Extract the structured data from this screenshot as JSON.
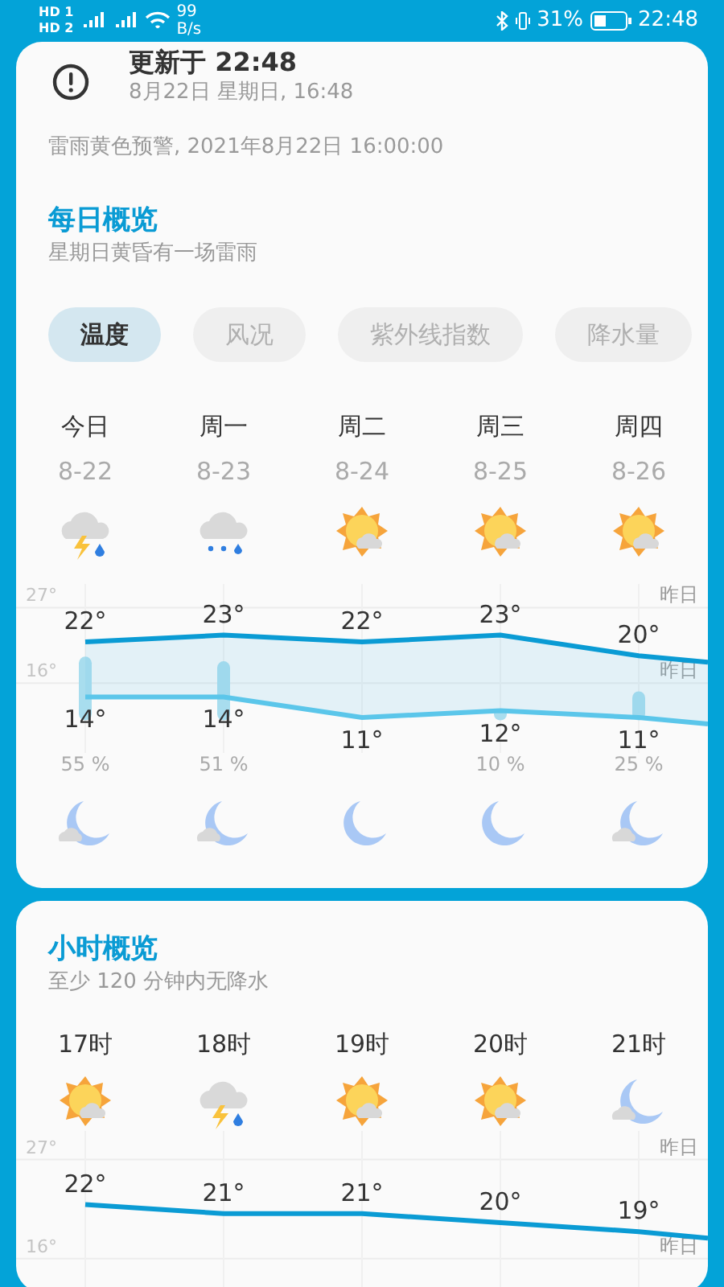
{
  "status_bar": {
    "sim_1": "HD 1",
    "sim_2": "HD 2",
    "net_speed": "99",
    "net_unit": "B/s",
    "battery": "31%",
    "time": "22:48"
  },
  "update": {
    "title": "更新于 22:48",
    "subtitle": "8月22日 星期日, 16:48"
  },
  "alert": "雷雨黄色预警, 2021年8月22日 16:00:00",
  "daily": {
    "title": "每日概览",
    "subtitle": "星期日黄昏有一场雷雨",
    "tabs": [
      {
        "label": "温度",
        "selected": true
      },
      {
        "label": "风况",
        "selected": false
      },
      {
        "label": "紫外线指数",
        "selected": false
      },
      {
        "label": "降水量",
        "selected": false
      }
    ],
    "ticks": [
      {
        "label": "27°",
        "ref": "昨日"
      },
      {
        "label": "16°",
        "ref": "昨日"
      }
    ],
    "days": [
      {
        "name": "今日",
        "date": "8-22",
        "day_icon": {
          "kind": "thunderstorm"
        },
        "high": "22°",
        "low": "14°",
        "rain": "55 %",
        "night_icon": {
          "kind": "cloudynight"
        }
      },
      {
        "name": "周一",
        "date": "8-23",
        "day_icon": {
          "kind": "rain"
        },
        "high": "23°",
        "low": "14°",
        "rain": "51 %",
        "night_icon": {
          "kind": "cloudynight"
        }
      },
      {
        "name": "周二",
        "date": "8-24",
        "day_icon": {
          "kind": "partlycloudy"
        },
        "high": "22°",
        "low": "11°",
        "night_icon": {
          "kind": "clearnight"
        }
      },
      {
        "name": "周三",
        "date": "8-25",
        "day_icon": {
          "kind": "partlycloudy"
        },
        "high": "23°",
        "low": "12°",
        "rain": "10 %",
        "night_icon": {
          "kind": "clearnight"
        }
      },
      {
        "name": "周四",
        "date": "8-26",
        "day_icon": {
          "kind": "partlycloudy"
        },
        "high": "20°",
        "low": "11°",
        "rain": "25 %",
        "night_icon": {
          "kind": "cloudynight"
        }
      }
    ]
  },
  "hourly": {
    "title": "小时概览",
    "subtitle": "至少 120 分钟内无降水",
    "ticks": [
      {
        "label": "27°",
        "ref": "昨日"
      },
      {
        "label": "16°",
        "ref": "昨日"
      }
    ],
    "hours": [
      {
        "time": "17时",
        "icon": {
          "kind": "partlycloudy"
        },
        "temp": "22°"
      },
      {
        "time": "18时",
        "icon": {
          "kind": "thunderstorm"
        },
        "temp": "21°"
      },
      {
        "time": "19时",
        "icon": {
          "kind": "partlycloudy"
        },
        "temp": "21°"
      },
      {
        "time": "20时",
        "icon": {
          "kind": "partlycloudy"
        },
        "temp": "20°"
      },
      {
        "time": "21时",
        "icon": {
          "kind": "cloudynight"
        },
        "temp": "19°"
      }
    ]
  }
}
